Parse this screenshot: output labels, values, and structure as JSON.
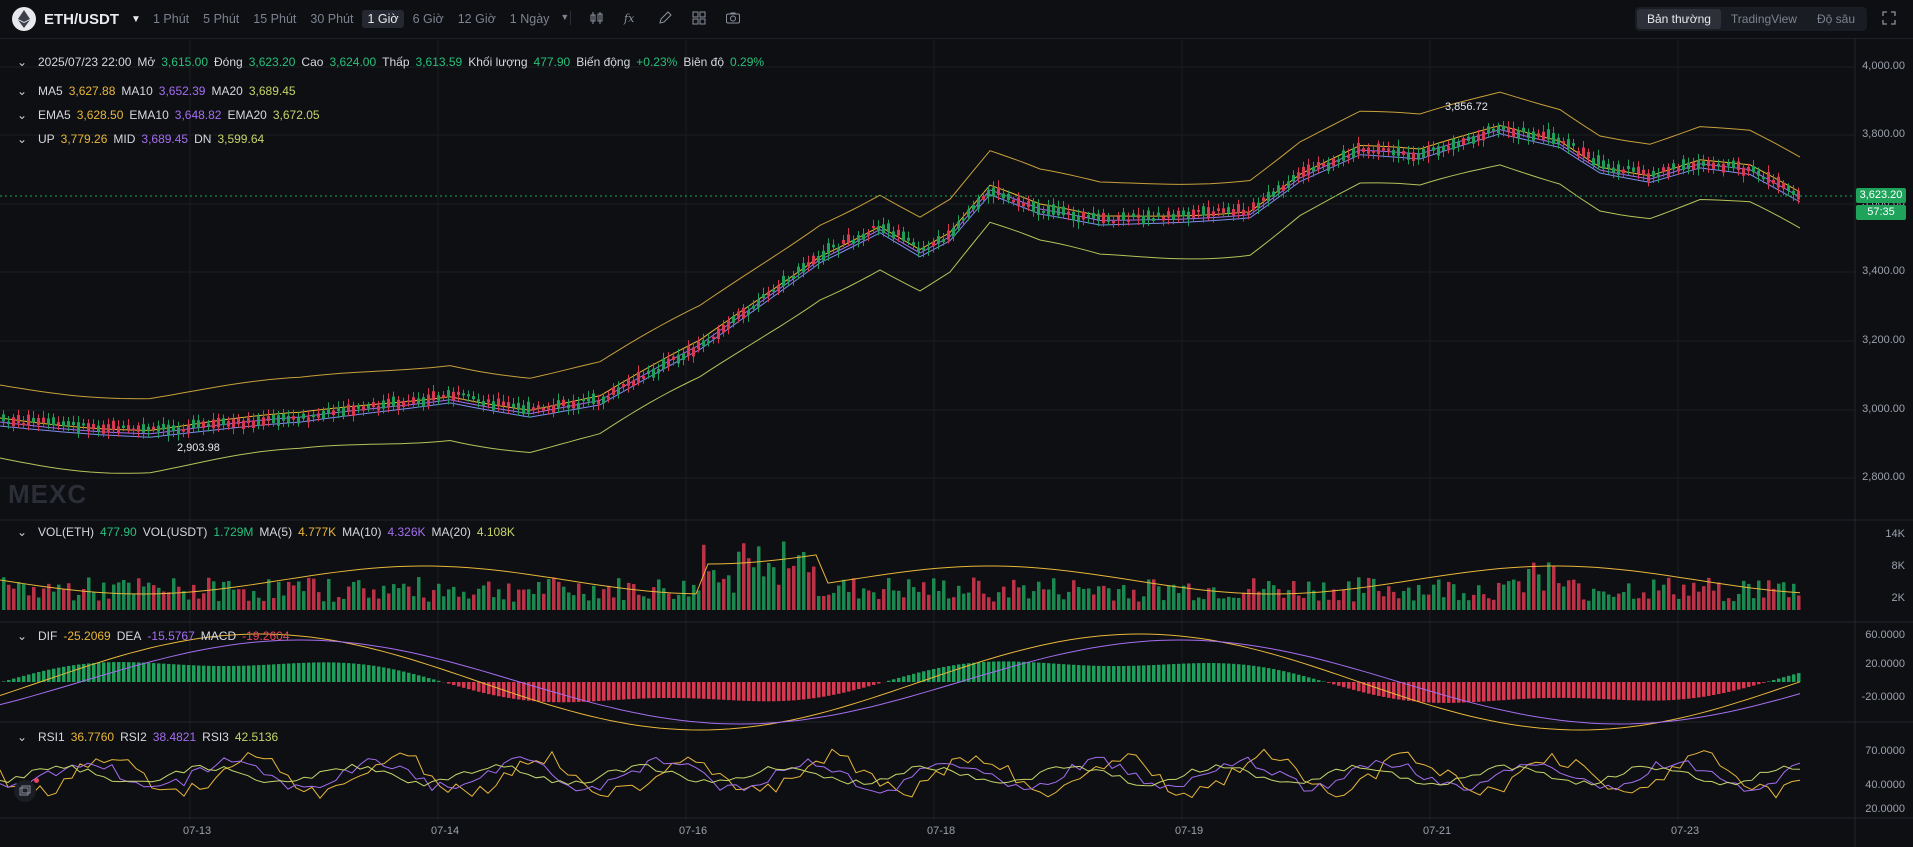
{
  "header": {
    "pair": "ETH/USDT",
    "intervals": [
      "1 Phút",
      "5 Phút",
      "15 Phút",
      "30 Phút",
      "1 Giờ",
      "6 Giờ",
      "12 Giờ",
      "1 Ngày"
    ],
    "active_interval": "1 Giờ",
    "views": [
      "Bản thường",
      "TradingView",
      "Độ sâu"
    ],
    "active_view": "Bản thường"
  },
  "ohlc": {
    "date": "2025/07/23 22:00",
    "open_label": "Mở",
    "open": "3,615.00",
    "close_label": "Đóng",
    "close": "3,623.20",
    "high_label": "Cao",
    "high": "3,624.00",
    "low_label": "Thấp",
    "low": "3,613.59",
    "vol_label": "Khối lượng",
    "vol": "477.90",
    "change_label": "Biến động",
    "change": "+0.23%",
    "amp_label": "Biên độ",
    "amp": "0.29%"
  },
  "ma": {
    "ma5_label": "MA5",
    "ma5": "3,627.88",
    "ma10_label": "MA10",
    "ma10": "3,652.39",
    "ma20_label": "MA20",
    "ma20": "3,689.45"
  },
  "ema": {
    "ema5_label": "EMA5",
    "ema5": "3,628.50",
    "ema10_label": "EMA10",
    "ema10": "3,648.82",
    "ema20_label": "EMA20",
    "ema20": "3,672.05"
  },
  "boll": {
    "up_label": "UP",
    "up": "3,779.26",
    "mid_label": "MID",
    "mid": "3,689.45",
    "dn_label": "DN",
    "dn": "3,599.64"
  },
  "vol": {
    "eth_label": "VOL(ETH)",
    "eth": "477.90",
    "usdt_label": "VOL(USDT)",
    "usdt": "1.729M",
    "ma5_label": "MA(5)",
    "ma5": "4.777K",
    "ma10_label": "MA(10)",
    "ma10": "4.326K",
    "ma20_label": "MA(20)",
    "ma20": "4.108K"
  },
  "macd": {
    "dif_label": "DIF",
    "dif": "-25.2069",
    "dea_label": "DEA",
    "dea": "-15.5767",
    "macd_label": "MACD",
    "macd": "-19.2604"
  },
  "rsi": {
    "rsi1_label": "RSI1",
    "rsi1": "36.7760",
    "rsi2_label": "RSI2",
    "rsi2": "38.4821",
    "rsi3_label": "RSI3",
    "rsi3": "42.5136"
  },
  "price_axis": [
    "4,000.00",
    "3,800.00",
    "3,600.00",
    "3,400.00",
    "3,200.00",
    "3,000.00",
    "2,800.00"
  ],
  "vol_axis": [
    "14K",
    "8K",
    "2K"
  ],
  "macd_axis": [
    "60.0000",
    "20.0000",
    "-20.0000"
  ],
  "rsi_axis": [
    "70.0000",
    "40.0000",
    "20.0000"
  ],
  "current_price": "3,623.20",
  "countdown": "57:35",
  "high_marker": "3,856.72",
  "low_marker": "2,903.98",
  "dates": [
    "07-13",
    "07-14",
    "07-16",
    "07-18",
    "07-19",
    "07-21",
    "07-23"
  ],
  "watermark": "MEXC",
  "colors": {
    "up": "#1f9e5a",
    "down": "#d8384f",
    "ma5": "#e8b73a",
    "ma10": "#a46ef0",
    "ma20": "#c7d46a",
    "bg": "#0e0f13"
  }
}
